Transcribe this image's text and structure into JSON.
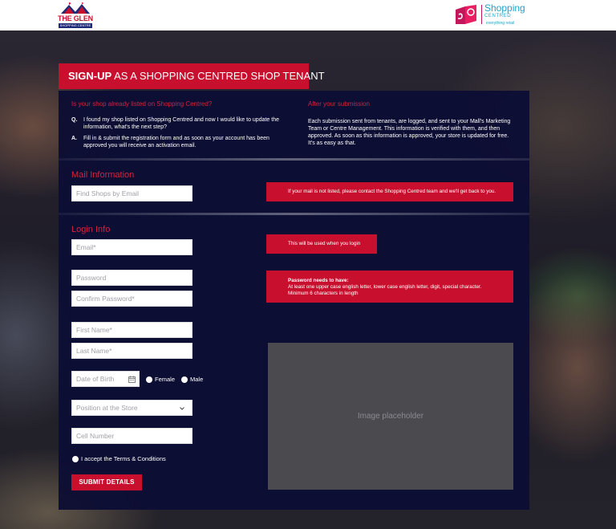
{
  "header": {
    "left_logo_text": "THE GLEN",
    "left_logo_sub": "SHOPPING CENTRE",
    "right_logo_name": "Shopping",
    "right_logo_centred": "CENTRED",
    "right_logo_tagline": "everything retail"
  },
  "title": {
    "bold": "SIGN-UP",
    "rest": " AS A SHOPPING CENTRED SHOP TENANT"
  },
  "intro": {
    "faq_heading": "Is your shop already listed on Shopping Centred?",
    "q_marker": "Q.",
    "q_text": "I found my shop listed on Shopping Centred and now I would like to update the information, what's the next step?",
    "a_marker": "A.",
    "a_text": "Fill in & submit the registration form and as soon as your account has been approved you will receive an activation email.",
    "after_heading": "After your submission",
    "after_text": "Each submission sent from tenants, are logged, and sent to your Mall's Marketing Team or Centre Management. This information is verified with them, and then approved. As soon as this information is approved, your store is updated for free. It's as easy as that."
  },
  "mail_section": {
    "heading": "Mail Information",
    "find_placeholder": "Find Shops by Email",
    "note": "If your mail is not listed, please contact the Shopping Centred team and we'll get back to you."
  },
  "login_section": {
    "heading": "Login Info",
    "email_placeholder": "Email*",
    "email_note": "This will be used when you login",
    "password_placeholder": "Password",
    "confirm_placeholder": "Confirm Password*",
    "password_note_title": "Password needs to have:",
    "password_note_body": "At least one upper case english letter, lower case english letter, digit, special character. Minimum 6 characters in length",
    "first_name_placeholder": "First Name*",
    "last_name_placeholder": "Last Name*",
    "dob_placeholder": "Date of Birth",
    "gender_options": [
      "Female",
      "Male"
    ],
    "position_placeholder": "Position at the Store",
    "cell_placeholder": "Cell Number",
    "terms_label": "I accept the Terms & Conditions",
    "submit_label": "SUBMIT DETAILS",
    "image_placeholder": "Image placeholder"
  },
  "icons": {
    "calendar": "calendar-icon",
    "chevron": "chevron-down-icon",
    "callout_arrow": "callout-arrow"
  },
  "colors": {
    "accent": "#c8102e",
    "panel": "#0c0e34",
    "brand_blue": "#1fa3c9",
    "brand_pink": "#c2185b"
  }
}
